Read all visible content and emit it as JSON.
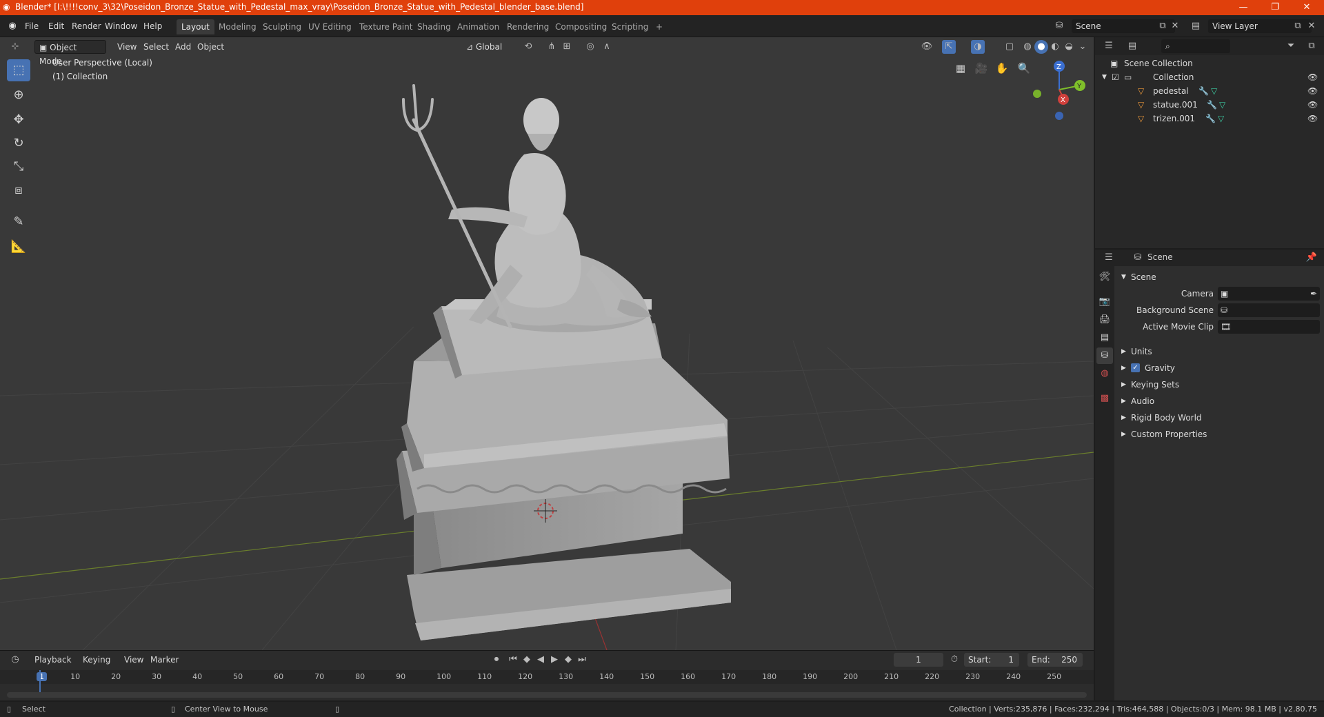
{
  "window": {
    "title": "Blender* [I:\\!!!!conv_3\\32\\Poseidon_Bronze_Statue_with_Pedestal_max_vray\\Poseidon_Bronze_Statue_with_Pedestal_blender_base.blend]",
    "minimize": "—",
    "restore": "❐",
    "close": "✕"
  },
  "menubar": {
    "items": [
      "File",
      "Edit",
      "Render",
      "Window",
      "Help"
    ],
    "workspaces": [
      "Layout",
      "Modeling",
      "Sculpting",
      "UV Editing",
      "Texture Paint",
      "Shading",
      "Animation",
      "Rendering",
      "Compositing",
      "Scripting"
    ],
    "add_workspace": "+",
    "scene": "Scene",
    "view_layer": "View Layer"
  },
  "viewport_header": {
    "mode": "Object Mode",
    "menus": [
      "View",
      "Select",
      "Add",
      "Object"
    ],
    "orientation": "Global"
  },
  "viewport": {
    "perspective": "User Perspective (Local)",
    "collection": "(1) Collection",
    "gizmo": {
      "z": "Z",
      "y": "Y",
      "x": "X"
    }
  },
  "outliner": {
    "root": "Scene Collection",
    "collection": "Collection",
    "objects": [
      "pedestal",
      "statue.001",
      "trizen.001"
    ]
  },
  "properties": {
    "context": "Scene",
    "panel": "Scene",
    "fields": [
      {
        "label": "Camera"
      },
      {
        "label": "Background Scene"
      },
      {
        "label": "Active Movie Clip"
      }
    ],
    "sections": [
      "Units",
      "Gravity",
      "Keying Sets",
      "Audio",
      "Rigid Body World",
      "Custom Properties"
    ],
    "gravity_checked": true
  },
  "timeline": {
    "menus": [
      "Playback",
      "Keying",
      "View",
      "Marker"
    ],
    "current_frame": "1",
    "start_label": "Start:",
    "start": "1",
    "end_label": "End:",
    "end": "250",
    "ticks": [
      "1",
      "10",
      "20",
      "30",
      "40",
      "50",
      "60",
      "70",
      "80",
      "90",
      "100",
      "110",
      "120",
      "130",
      "140",
      "150",
      "160",
      "170",
      "180",
      "190",
      "200",
      "210",
      "220",
      "230",
      "240",
      "250"
    ]
  },
  "statusbar": {
    "left": "Select",
    "middle": "Center View to Mouse",
    "stats": "Collection | Verts:235,876 | Faces:232,294 | Tris:464,588 | Objects:0/3 | Mem: 98.1 MB | v2.80.75"
  },
  "colors": {
    "accent": "#4772b3",
    "title_bar": "#e0400c",
    "viewport_bg": "#393939"
  }
}
